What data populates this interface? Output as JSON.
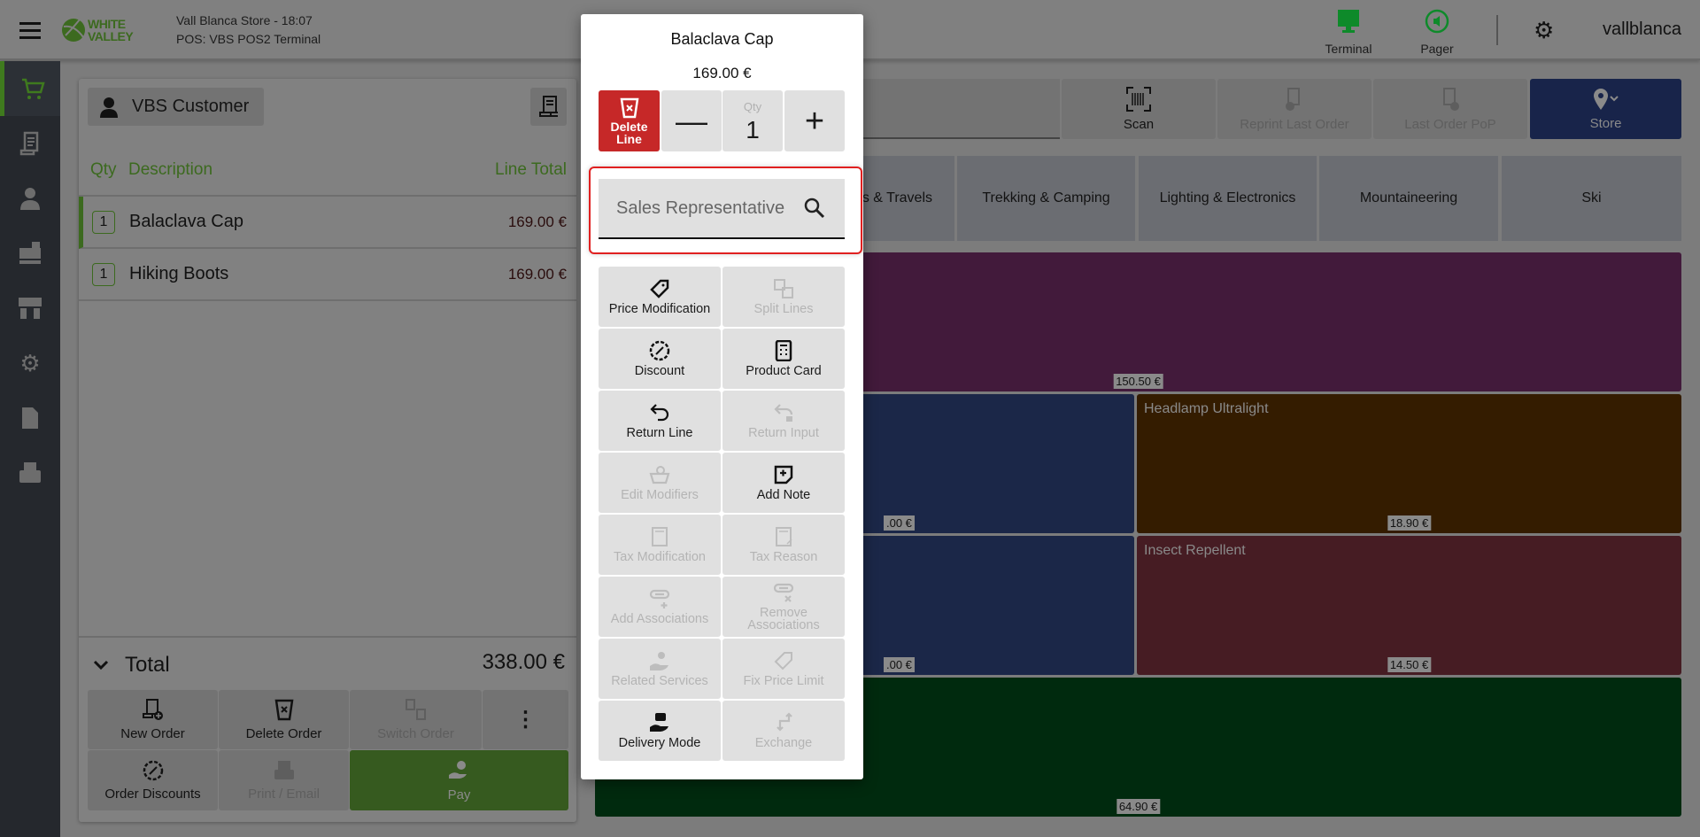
{
  "header": {
    "logo_text": "WHITE VALLEY",
    "store_line": "Vall Blanca Store - 18:07",
    "pos_line": "POS: VBS POS2 Terminal",
    "terminal_label": "Terminal",
    "pager_label": "Pager",
    "username": "vallblanca"
  },
  "sidebar": {
    "items": [
      {
        "icon": "cart-icon",
        "active": true
      },
      {
        "icon": "receipt-icon"
      },
      {
        "icon": "user-icon"
      },
      {
        "icon": "cash-register-icon"
      },
      {
        "icon": "store-icon"
      },
      {
        "icon": "gear-icon"
      },
      {
        "icon": "document-icon"
      },
      {
        "icon": "printer-icon"
      }
    ]
  },
  "order": {
    "customer": "VBS Customer",
    "columns": {
      "qty": "Qty",
      "description": "Description",
      "total": "Line Total"
    },
    "lines": [
      {
        "qty": "1",
        "description": "Balaclava Cap",
        "total": "169.00 €",
        "selected": true
      },
      {
        "qty": "1",
        "description": "Hiking Boots",
        "total": "169.00 €"
      }
    ],
    "total_label": "Total",
    "total_value": "338.00 €",
    "buttons": {
      "new_order": "New Order",
      "delete_order": "Delete Order",
      "switch_order": "Switch Order",
      "order_discounts": "Order Discounts",
      "print_email": "Print / Email",
      "pay": "Pay"
    }
  },
  "toolbar": {
    "scan": "Scan",
    "reprint": "Reprint Last Order",
    "last_pop": "Last Order PoP",
    "store": "Store"
  },
  "categories": [
    "s & Travels",
    "Trekking & Camping",
    "Lighting & Electronics",
    "Mountaineering",
    "Ski"
  ],
  "products": [
    {
      "name": "",
      "price": "150.50 €",
      "color": "#421a3b"
    },
    {
      "name": "",
      "price": ".00 €",
      "color": "#1b2748"
    },
    {
      "name": "Headlamp Ultralight",
      "price": "18.90 €",
      "color": "#341c00"
    },
    {
      "name": "",
      "price": ".00 €",
      "color": "#1b2748"
    },
    {
      "name": "Insect Repellent",
      "price": "14.50 €",
      "color": "#461c23"
    },
    {
      "name": "",
      "price": "64.90 €",
      "color": "#002a0e"
    }
  ],
  "modal": {
    "title": "Balaclava Cap",
    "price": "169.00 €",
    "delete_line": "Delete Line",
    "qty_label": "Qty",
    "qty_value": "1",
    "sales_rep_placeholder": "Sales Representative",
    "actions": [
      {
        "label": "Price Modification",
        "enabled": true
      },
      {
        "label": "Split Lines",
        "enabled": false
      },
      {
        "label": "Discount",
        "enabled": true
      },
      {
        "label": "Product Card",
        "enabled": true
      },
      {
        "label": "Return Line",
        "enabled": true
      },
      {
        "label": "Return Input",
        "enabled": false
      },
      {
        "label": "Edit Modifiers",
        "enabled": false
      },
      {
        "label": "Add Note",
        "enabled": true
      },
      {
        "label": "Tax Modification",
        "enabled": false
      },
      {
        "label": "Tax Reason",
        "enabled": false
      },
      {
        "label": "Add Associations",
        "enabled": false
      },
      {
        "label": "Remove Associations",
        "enabled": false
      },
      {
        "label": "Related Services",
        "enabled": false
      },
      {
        "label": "Fix Price Limit",
        "enabled": false
      },
      {
        "label": "Delivery Mode",
        "enabled": true
      },
      {
        "label": "Exchange",
        "enabled": false
      }
    ]
  },
  "colors": {
    "accent": "#3c6a1f",
    "danger": "#c62828",
    "store": "#18244a",
    "pay": "#365a1f"
  }
}
